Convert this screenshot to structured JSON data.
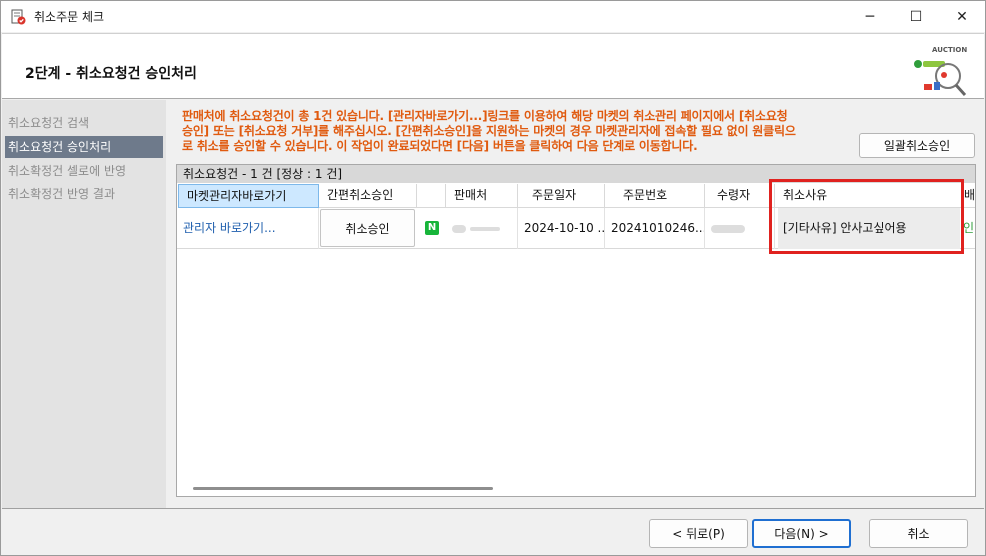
{
  "window": {
    "title": "취소주문 체크",
    "minimize": "─",
    "maximize": "☐",
    "close": "✕"
  },
  "header": {
    "step_title": "2단계 - 취소요청건 승인처리",
    "logo_text": "AUCTION"
  },
  "sidebar": {
    "items": [
      {
        "label": "취소요청건 검색",
        "active": false
      },
      {
        "label": "취소요청건 승인처리",
        "active": true
      },
      {
        "label": "취소확정건 셀로에 반영",
        "active": false
      },
      {
        "label": "취소확정건 반영 결과",
        "active": false
      }
    ]
  },
  "notice": {
    "line1": "판매처에 취소요청건이 총 1건 있습니다. [관리자바로가기...]링크를 이용하여 해당 마켓의 취소관리 페이지에서 [취소요청",
    "line2": "승인] 또는 [취소요청 거부]를 해주십시오. [간편취소승인]을 지원하는 마켓의 경우 마켓관리자에 접속할 필요 없이 원클릭으",
    "line3": "로 취소를 승인할 수 있습니다. 이 작업이 완료되었다면 [다음] 버튼을 클릭하여 다음 단계로 이동합니다."
  },
  "bulk_button": "일괄취소승인",
  "grid": {
    "caption": "취소요청건 - 1 건 [정상 : 1 건]",
    "columns": [
      "마켓관리자바로가기",
      "간편취소승인",
      "",
      "판매처",
      "주문일자",
      "주문번호",
      "수령자",
      "취소사유",
      "배"
    ],
    "row": {
      "admin_link": "관리자 바로가기...",
      "quick_cancel": "취소승인",
      "market_badge": "N",
      "order_date": "2024-10-10 ...",
      "order_no": "20241010246...",
      "reason": "[기타사유] 안사고싶어용",
      "extra": "인"
    }
  },
  "footer": {
    "back": "< 뒤로(P)",
    "next": "다음(N) >",
    "cancel": "취소"
  }
}
